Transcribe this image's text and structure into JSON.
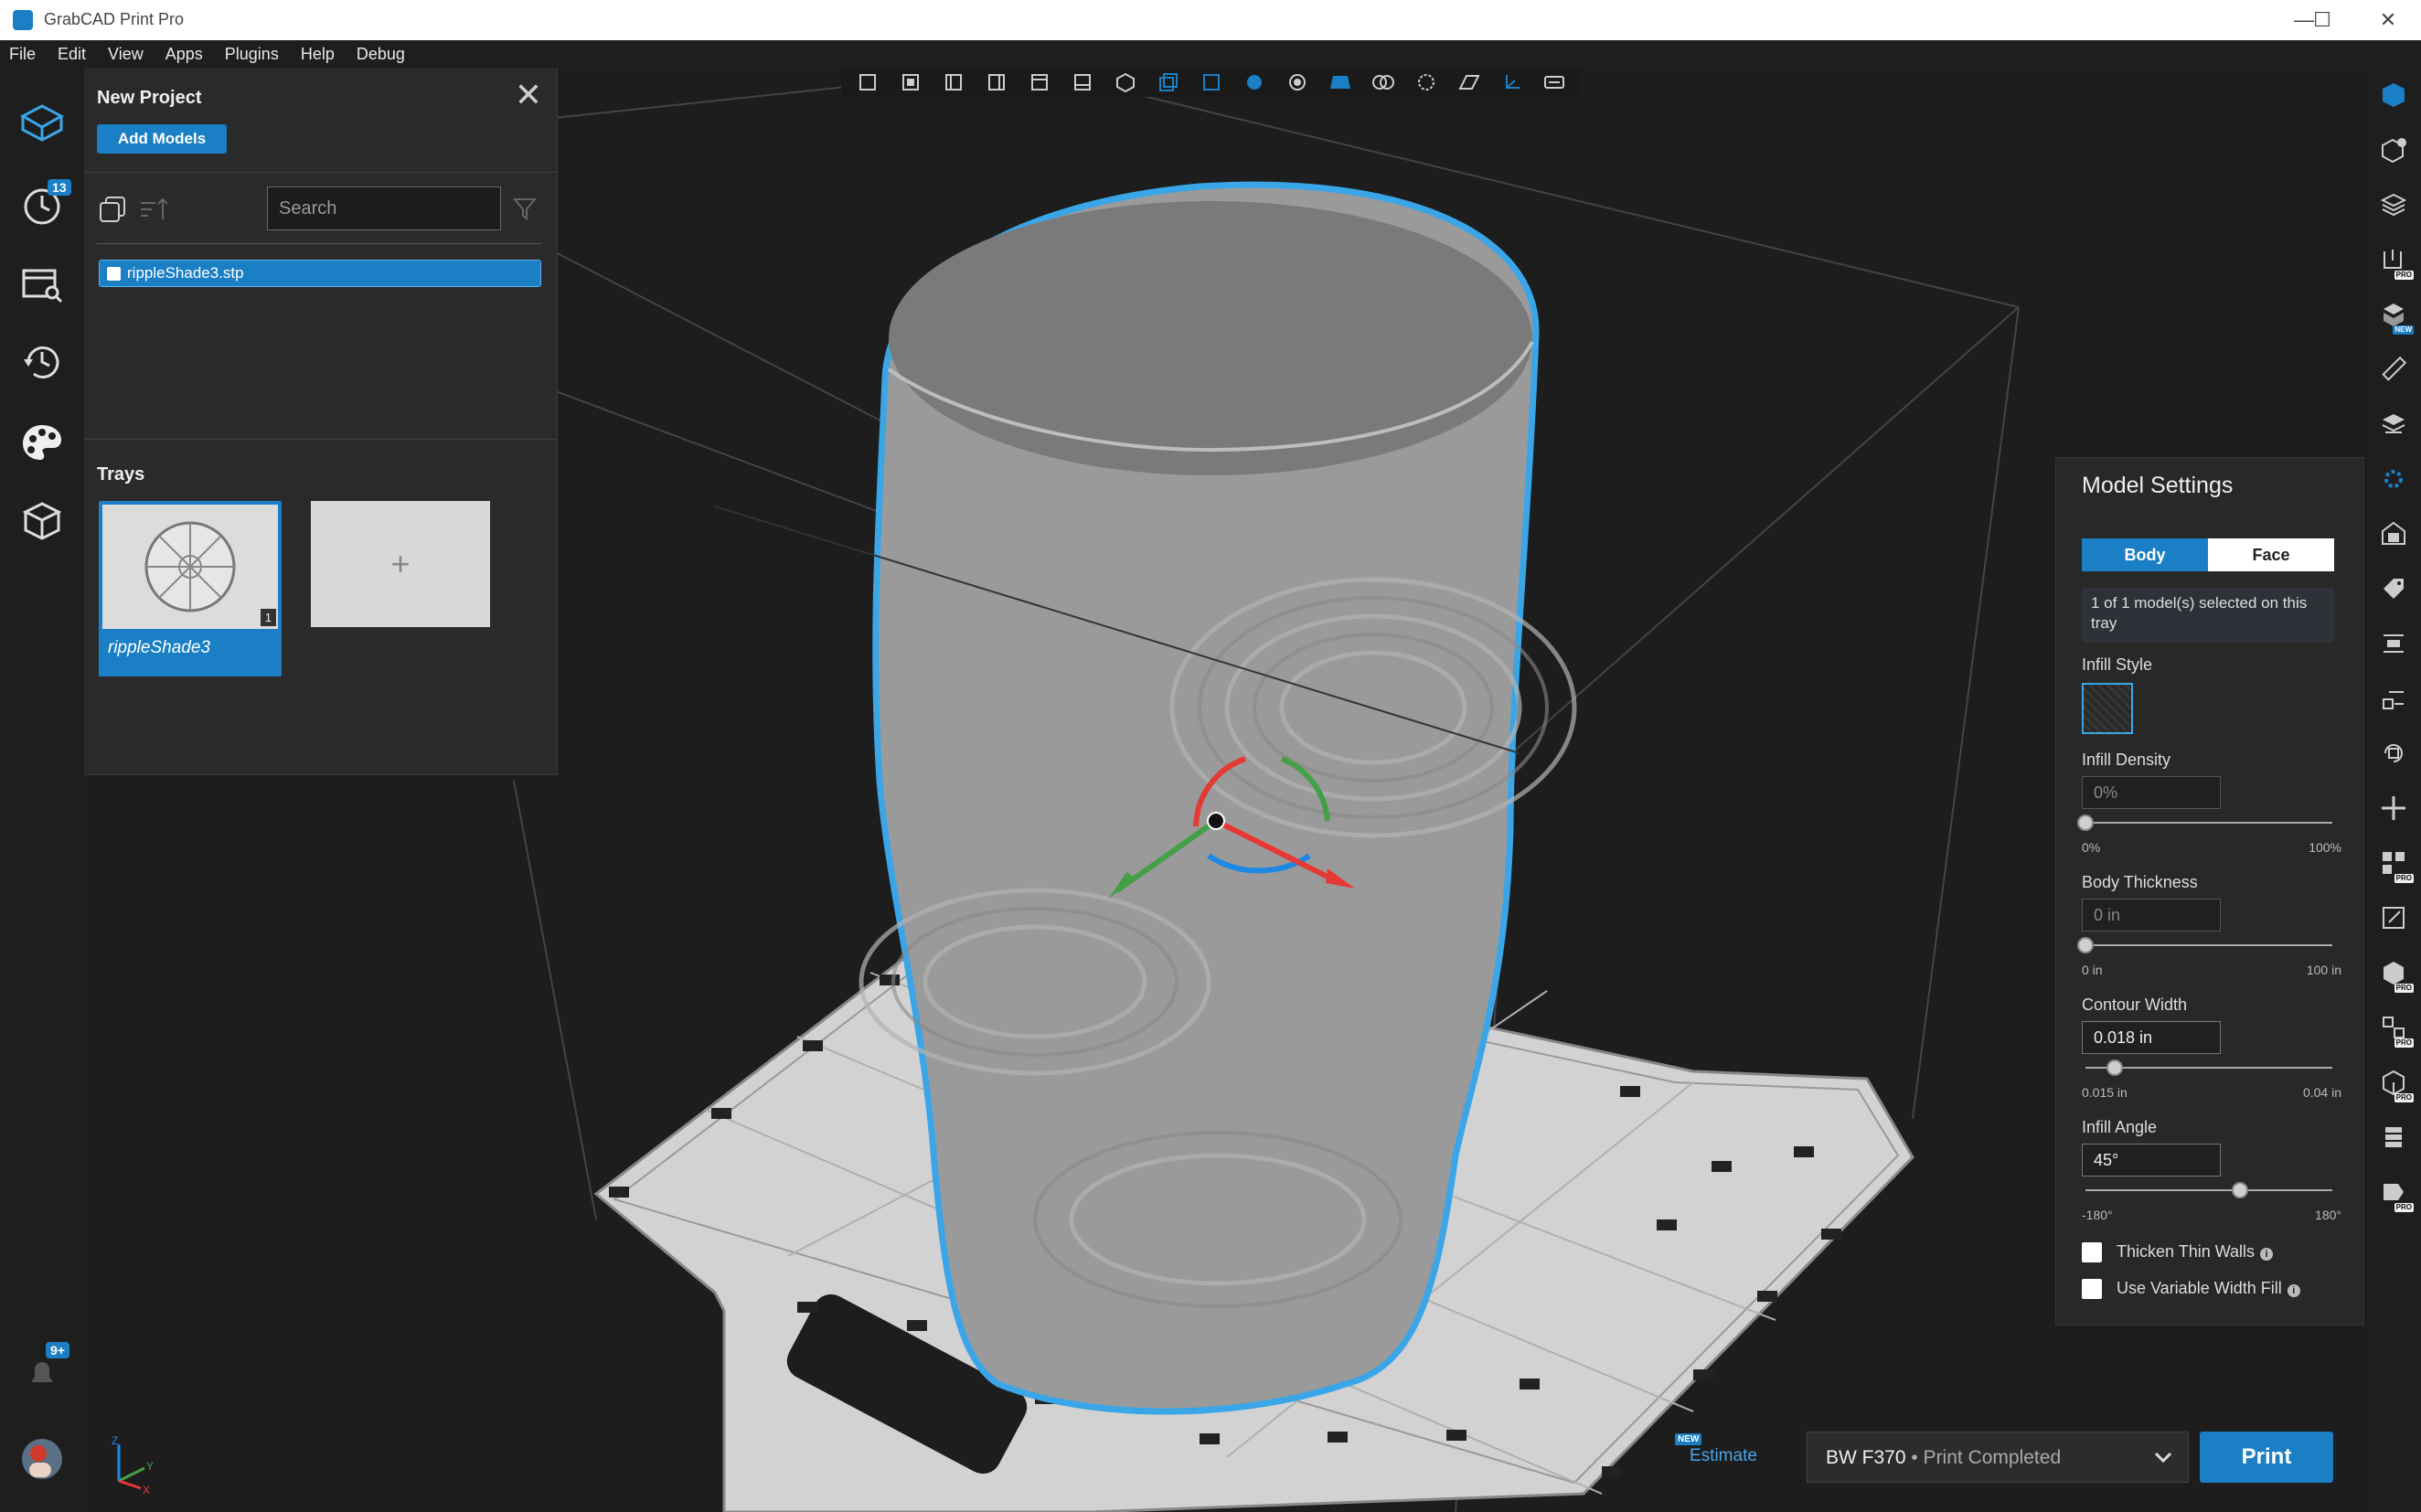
{
  "window": {
    "title": "GrabCAD Print Pro",
    "minimize": "—",
    "maximize": "☐",
    "close": "✕"
  },
  "menu": [
    "File",
    "Edit",
    "View",
    "Apps",
    "Plugins",
    "Help",
    "Debug"
  ],
  "left_rail": {
    "history_badge": "13",
    "notifications_badge": "9+"
  },
  "project": {
    "title": "New Project",
    "add_models_label": "Add Models",
    "search_placeholder": "Search",
    "models": [
      {
        "name": "rippleShade3.stp"
      }
    ],
    "trays_label": "Trays",
    "trays": [
      {
        "name": "rippleShade3",
        "model_count": "1"
      }
    ],
    "add_tray_label": "+"
  },
  "model_settings": {
    "title": "Model Settings",
    "tabs": {
      "body": "Body",
      "face": "Face",
      "active": "Body"
    },
    "selection_info": "1 of 1 model(s) selected on this tray",
    "infill_style_label": "Infill Style",
    "infill_density": {
      "label": "Infill Density",
      "value": "0%",
      "min": "0%",
      "max": "100%",
      "fraction": 0.0
    },
    "body_thickness": {
      "label": "Body Thickness",
      "value": "0 in",
      "min": "0 in",
      "max": "100 in",
      "fraction": 0.0
    },
    "contour_width": {
      "label": "Contour Width",
      "value": "0.018 in",
      "min": "0.015 in",
      "max": "0.04 in",
      "fraction": 0.12
    },
    "infill_angle": {
      "label": "Infill Angle",
      "value": "45°",
      "min": "-180°",
      "max": "180°",
      "fraction": 0.625
    },
    "thicken_thin_walls": {
      "label": "Thicken Thin Walls",
      "checked": false
    },
    "variable_width_fill": {
      "label": "Use Variable Width Fill",
      "checked": false
    }
  },
  "bottom_bar": {
    "estimate_badge": "NEW",
    "estimate_label": "Estimate",
    "printer_name": "BW F370",
    "printer_status": "• Print Completed",
    "print_label": "Print"
  },
  "pro_badge": "PRO",
  "new_badge": "NEW",
  "colors": {
    "accent": "#1a7fc4",
    "selection_outline": "#3aa6e8",
    "panel": "#2a2a2a",
    "viewport": "#1d1d1d"
  }
}
